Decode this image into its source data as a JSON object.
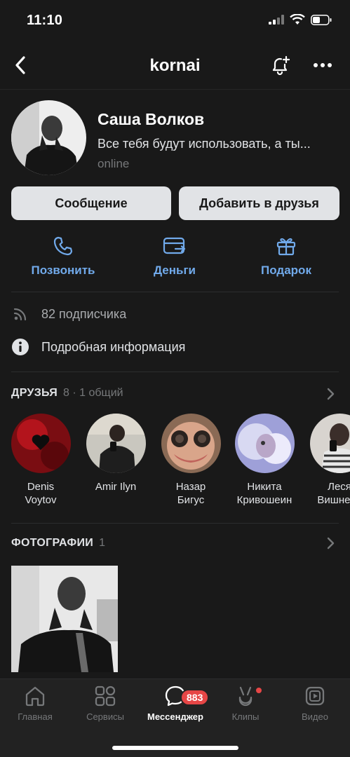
{
  "status_bar": {
    "time": "11:10"
  },
  "nav": {
    "title": "kornai"
  },
  "profile": {
    "name": "Саша Волков",
    "status": "Все тебя будут использовать, а ты...",
    "online": "online"
  },
  "buttons": {
    "message": "Сообщение",
    "add_friend": "Добавить в друзья"
  },
  "actions": [
    {
      "label": "Позвонить",
      "icon": "phone-icon"
    },
    {
      "label": "Деньги",
      "icon": "money-icon"
    },
    {
      "label": "Подарок",
      "icon": "gift-icon"
    }
  ],
  "info": {
    "followers": "82 подписчика",
    "details": "Подробная информация"
  },
  "friends_section": {
    "title": "ДРУЗЬЯ",
    "count": "8 · 1 общий",
    "items": [
      {
        "name": "Denis\nVoytov"
      },
      {
        "name": "Amir Ilyn"
      },
      {
        "name": "Назар\nБигус"
      },
      {
        "name": "Никита\nКривошеин"
      },
      {
        "name": "Леся\nВишнева"
      }
    ]
  },
  "photos_section": {
    "title": "ФОТОГРАФИИ",
    "count": "1"
  },
  "tabbar": {
    "items": [
      {
        "label": "Главная",
        "icon": "home-icon"
      },
      {
        "label": "Сервисы",
        "icon": "services-icon"
      },
      {
        "label": "Мессенджер",
        "icon": "messenger-icon",
        "badge": "883"
      },
      {
        "label": "Клипы",
        "icon": "clips-icon"
      },
      {
        "label": "Видео",
        "icon": "video-icon"
      }
    ]
  },
  "colors": {
    "accent": "#71aaeb",
    "background": "#191919",
    "badge": "#e64646"
  }
}
